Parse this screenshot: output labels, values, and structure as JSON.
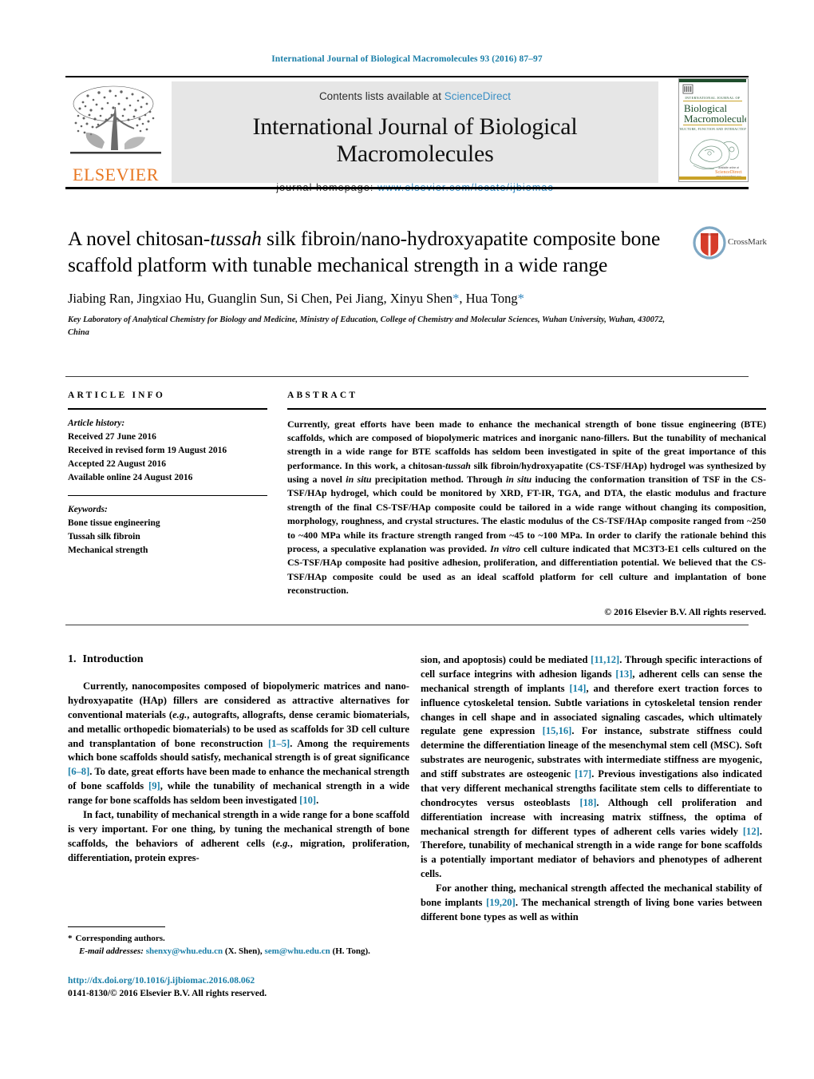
{
  "running_head": "International Journal of Biological Macromolecules 93 (2016) 87–97",
  "masthead": {
    "contents_prefix": "Contents lists available at ",
    "sciencedirect": "ScienceDirect",
    "journal_title": "International Journal of Biological Macromolecules",
    "homepage_prefix": "journal homepage: ",
    "homepage_url": "www.elsevier.com/locate/ijbiomac",
    "publisher_logo_text": "ELSEVIER",
    "cover": {
      "kicker": "INTERNATIONAL JOURNAL OF",
      "line1": "Biological",
      "line2": "Macromolecules",
      "subtitle": "STRUCTURE, FUNCTION AND INTERACTIONS",
      "footer_kicker": "available online at",
      "footer": "ScienceDirect",
      "footer_sub": "www.sciencedirect.com"
    }
  },
  "crossmark": {
    "label": "CrossMark"
  },
  "article": {
    "title_part1": "A novel chitosan-",
    "title_italic": "tussah",
    "title_part2": " silk fibroin/nano-hydroxyapatite composite bone scaffold platform with tunable mechanical strength in a wide range",
    "authors": "Jiabing Ran, Jingxiao Hu, Guanglin Sun, Si Chen, Pei Jiang, Xinyu Shen",
    "authors_tail": ", Hua Tong",
    "author_star": "*",
    "affiliation": "Key Laboratory of Analytical Chemistry for Biology and Medicine, Ministry of Education, College of Chemistry and Molecular Sciences, Wuhan University, Wuhan, 430072, China"
  },
  "article_info": {
    "heading": "ARTICLE INFO",
    "history_label": "Article history:",
    "history": [
      "Received 27 June 2016",
      "Received in revised form 19 August 2016",
      "Accepted 22 August 2016",
      "Available online 24 August 2016"
    ],
    "keywords_label": "Keywords:",
    "keywords": [
      "Bone tissue engineering",
      "Tussah silk fibroin",
      "Mechanical strength"
    ]
  },
  "abstract": {
    "heading": "ABSTRACT",
    "text_1": "Currently, great efforts have been made to enhance the mechanical strength of bone tissue engineering (BTE) scaffolds, which are composed of biopolymeric matrices and inorganic nano-fillers. But the tunability of mechanical strength in a wide range for BTE scaffolds has seldom been investigated in spite of the great importance of this performance. In this work, a chitosan-",
    "italic_1": "tussah",
    "text_2": " silk fibroin/hydroxyapatite (CS-TSF/HAp) hydrogel was synthesized by using a novel ",
    "italic_2": "in situ",
    "text_3": " precipitation method. Through ",
    "italic_3": "in situ",
    "text_4": " inducing the conformation transition of TSF in the CS-TSF/HAp hydrogel, which could be monitored by XRD, FT-IR, TGA, and DTA, the elastic modulus and fracture strength of the final CS-TSF/HAp composite could be tailored in a wide range without changing its composition, morphology, roughness, and crystal structures. The elastic modulus of the CS-TSF/HAp composite ranged from ~250 to ~400 MPa while its fracture strength ranged from ~45 to ~100 MPa. In order to clarify the rationale behind this process, a speculative explanation was provided. ",
    "italic_4": "In vitro",
    "text_5": " cell culture indicated that MC3T3-E1 cells cultured on the CS-TSF/HAp composite had positive adhesion, proliferation, and differentiation potential. We believed that the CS-TSF/HAp composite could be used as an ideal scaffold platform for cell culture and implantation of bone reconstruction.",
    "copyright": "© 2016 Elsevier B.V. All rights reserved."
  },
  "body": {
    "section_number": "1.",
    "section_title": "Introduction",
    "left": {
      "p1_a": "Currently, nanocomposites composed of biopolymeric matrices and nano-hydroxyapatite (HAp) fillers are considered as attractive alternatives for conventional materials (",
      "p1_em1": "e.g.",
      "p1_b": ", autografts, allografts, dense ceramic biomaterials, and metallic orthopedic biomaterials) to be used as scaffolds for 3D cell culture and transplantation of bone reconstruction ",
      "p1_ref1": "[1–5]",
      "p1_c": ". Among the requirements which bone scaffolds should satisfy, mechanical strength is of great significance ",
      "p1_ref2": "[6–8]",
      "p1_d": ". To date, great efforts have been made to enhance the mechanical strength of bone scaffolds ",
      "p1_ref3": "[9]",
      "p1_e": ", while the tunability of mechanical strength in a wide range for bone scaffolds has seldom been investigated ",
      "p1_ref4": "[10]",
      "p1_f": ".",
      "p2_a": "In fact, tunability of mechanical strength in a wide range for a bone scaffold is very important. For one thing, by tuning the mechanical strength of bone scaffolds, the behaviors of adherent cells (",
      "p2_em1": "e.g.",
      "p2_b": ", migration, proliferation, differentiation, protein expres-"
    },
    "right": {
      "p2_c": "sion, and apoptosis) could be mediated ",
      "p2_ref1": "[11,12]",
      "p2_d": ". Through specific interactions of cell surface integrins with adhesion ligands ",
      "p2_ref2": "[13]",
      "p2_e": ", adherent cells can sense the mechanical strength of implants ",
      "p2_ref3": "[14]",
      "p2_f": ", and therefore exert traction forces to influence cytoskeletal tension. Subtle variations in cytoskeletal tension render changes in cell shape and in associated signaling cascades, which ultimately regulate gene expression ",
      "p2_ref4": "[15,16]",
      "p2_g": ". For instance, substrate stiffness could determine the differentiation lineage of the mesenchymal stem cell (MSC). Soft substrates are neurogenic, substrates with intermediate stiffness are myogenic, and stiff substrates are osteogenic ",
      "p2_ref5": "[17]",
      "p2_h": ". Previous investigations also indicated that very different mechanical strengths facilitate stem cells to differentiate to chondrocytes versus osteoblasts ",
      "p2_ref6": "[18]",
      "p2_i": ". Although cell proliferation and differentiation increase with increasing matrix stiffness, the optima of mechanical strength for different types of adherent cells varies widely ",
      "p2_ref7": "[12]",
      "p2_j": ". Therefore, tunability of mechanical strength in a wide range for bone scaffolds is a potentially important mediator of behaviors and phenotypes of adherent cells.",
      "p3_a": "For another thing, mechanical strength affected the mechanical stability of bone implants ",
      "p3_ref1": "[19,20]",
      "p3_b": ". The mechanical strength of living bone varies between different bone types as well as within"
    }
  },
  "footnote": {
    "star": "*",
    "corresponding": "Corresponding authors.",
    "email_label": "E-mail addresses:",
    "email_1": "shenxy@whu.edu.cn",
    "email_1_who": " (X. Shen), ",
    "email_2": "sem@whu.edu.cn",
    "email_2_who": " (H. Tong)."
  },
  "footer": {
    "doi": "http://dx.doi.org/10.1016/j.ijbiomac.2016.08.062",
    "issn": "0141-8130/© 2016 Elsevier B.V. All rights reserved."
  },
  "colors": {
    "link_blue": "#1b7fa8",
    "sciencedirect_blue": "#3b8fc4",
    "elsevier_orange": "#e87722",
    "band_gray": "#e6e6e6",
    "crossmark_red": "#d63c2a",
    "crossmark_ring": "#7fa8c4"
  }
}
